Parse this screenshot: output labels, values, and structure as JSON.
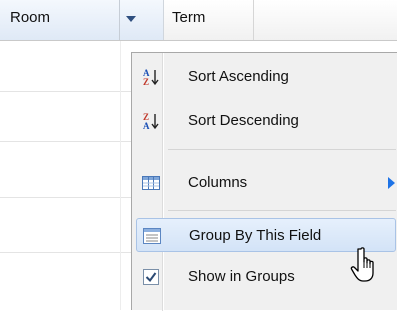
{
  "header": {
    "room_label": "Room",
    "term_label": "Term"
  },
  "menu": {
    "items": [
      {
        "label": "Sort Ascending",
        "icon": "sort-ascending-icon"
      },
      {
        "label": "Sort Descending",
        "icon": "sort-descending-icon"
      },
      {
        "label": "Columns",
        "icon": "columns-icon",
        "has_submenu": true
      },
      {
        "label": "Group By This Field",
        "icon": "group-by-icon",
        "highlighted": true
      },
      {
        "label": "Show in Groups",
        "icon": "checkbox-icon",
        "checked": true
      }
    ]
  },
  "colors": {
    "menu_background": "#f0f0f0",
    "highlight_background": "#d3e3f7",
    "submenu_arrow": "#1e73e6",
    "header_active": "#dfe9f6"
  }
}
